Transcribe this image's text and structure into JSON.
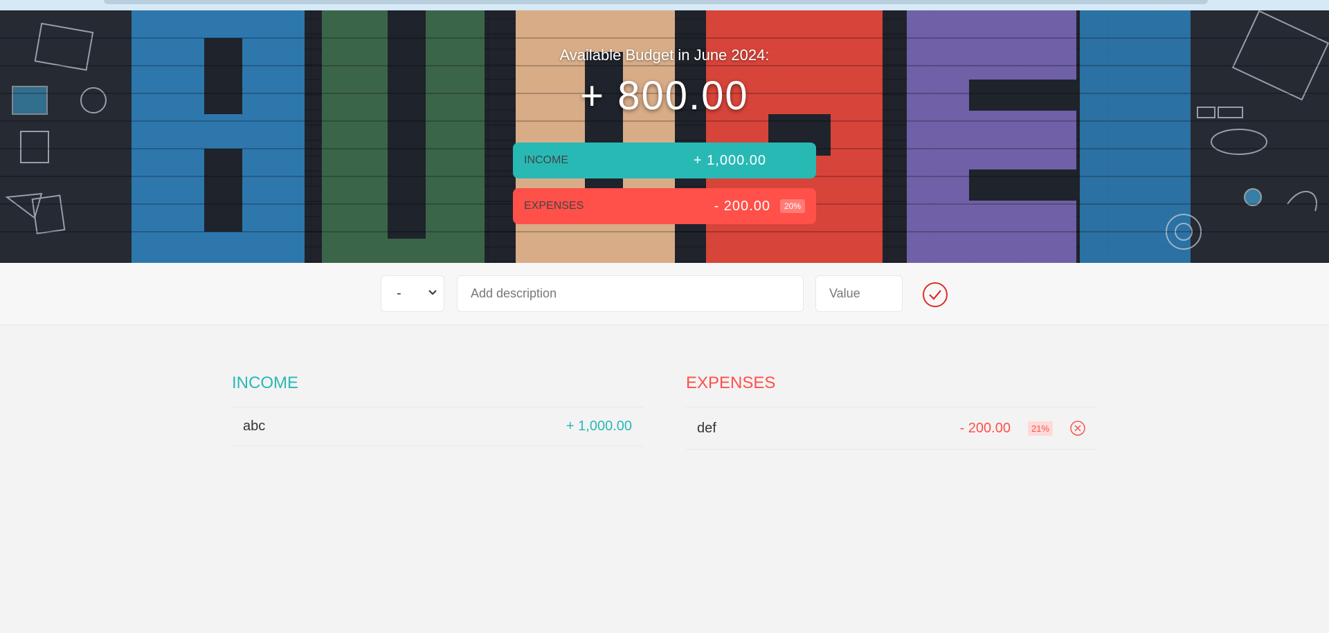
{
  "header": {
    "title": "Available Budget in June 2024:",
    "available_budget": "+ 800.00"
  },
  "summary": {
    "income": {
      "label": "INCOME",
      "value": "+ 1,000.00"
    },
    "expenses": {
      "label": "EXPENSES",
      "value": "- 200.00",
      "percentage": "20%"
    }
  },
  "add_form": {
    "type_value": "-",
    "description_placeholder": "Add description",
    "value_placeholder": "Value",
    "add_icon": "checkmark-circle-icon"
  },
  "income_list": {
    "title": "INCOME",
    "items": [
      {
        "description": "abc",
        "value": "+ 1,000.00"
      }
    ]
  },
  "expenses_list": {
    "title": "EXPENSES",
    "items": [
      {
        "description": "def",
        "value": "- 200.00",
        "percentage": "21%"
      }
    ],
    "delete_icon": "close-circle-icon"
  },
  "colors": {
    "income": "#28b9b5",
    "expenses": "#ff5049",
    "background": "#f3f3f3"
  }
}
